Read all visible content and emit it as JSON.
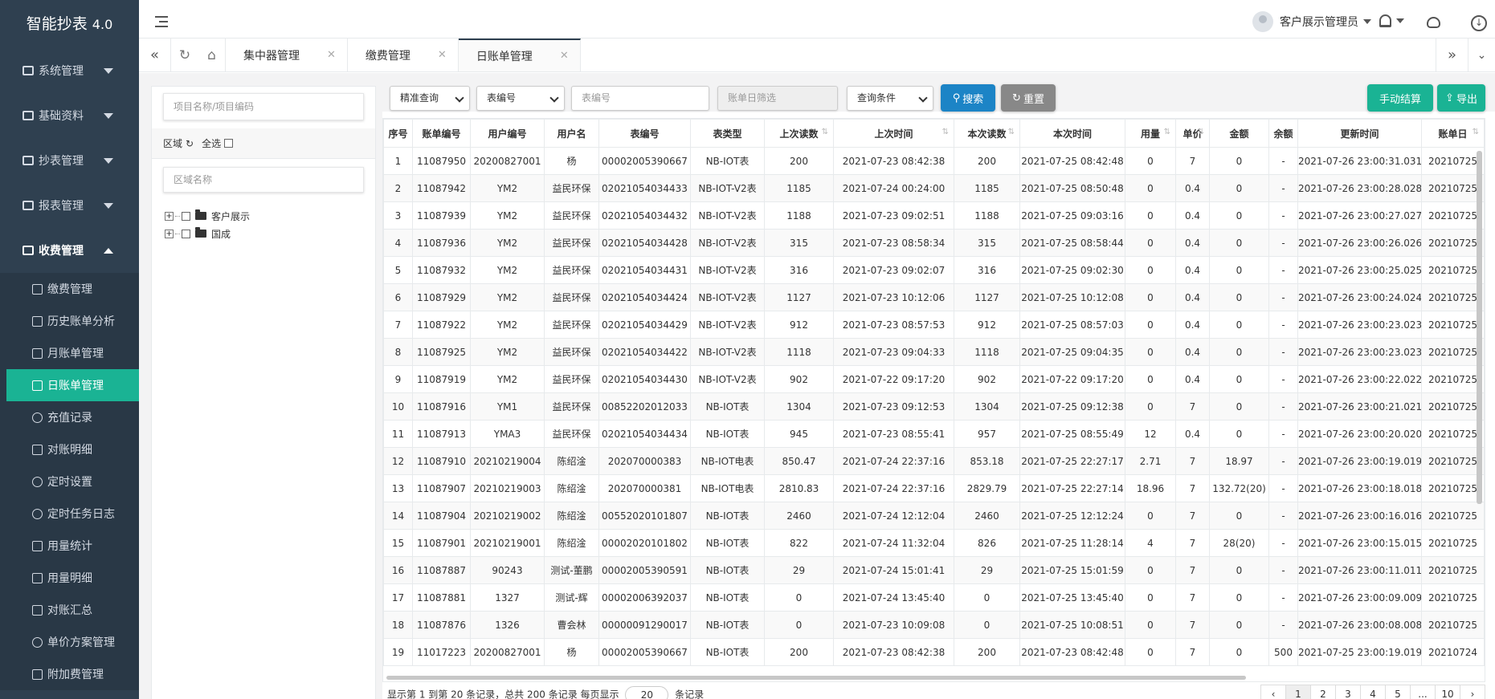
{
  "app": {
    "title": "智能抄表",
    "version": "4.0"
  },
  "sidebar": {
    "menus": [
      {
        "label": "系统管理",
        "icon": "grid-icon",
        "open": false
      },
      {
        "label": "基础资料",
        "icon": "list-icon",
        "open": false
      },
      {
        "label": "抄表管理",
        "icon": "meter-icon",
        "open": false
      },
      {
        "label": "报表管理",
        "icon": "bar-chart-icon",
        "open": false
      },
      {
        "label": "收费管理",
        "icon": "cash-icon",
        "open": true
      }
    ],
    "submenu": [
      {
        "label": "缴费管理",
        "icon": "money-icon",
        "active": false
      },
      {
        "label": "历史账单分析",
        "icon": "calendar-icon",
        "active": false
      },
      {
        "label": "月账单管理",
        "icon": "document-icon",
        "active": false
      },
      {
        "label": "日账单管理",
        "icon": "calendar-icon",
        "active": true
      },
      {
        "label": "充值记录",
        "icon": "clock-icon",
        "active": false
      },
      {
        "label": "对账明细",
        "icon": "calendar-icon",
        "active": false
      },
      {
        "label": "定时设置",
        "icon": "alarm-icon",
        "active": false
      },
      {
        "label": "定时任务日志",
        "icon": "clock-icon",
        "active": false
      },
      {
        "label": "用量统计",
        "icon": "document-icon",
        "active": false
      },
      {
        "label": "用量明细",
        "icon": "document-icon",
        "active": false
      },
      {
        "label": "对账汇总",
        "icon": "document-icon",
        "active": false
      },
      {
        "label": "单价方案管理",
        "icon": "refresh-icon",
        "active": false
      },
      {
        "label": "附加费管理",
        "icon": "money-icon",
        "active": false
      }
    ]
  },
  "header": {
    "user_name": "客户展示管理员"
  },
  "tabs": [
    {
      "label": "集中器管理",
      "active": false
    },
    {
      "label": "缴费管理",
      "active": false
    },
    {
      "label": "日账单管理",
      "active": true
    }
  ],
  "left_panel": {
    "project_placeholder": "项目名称/项目编码",
    "region_label": "区域",
    "select_all_label": "全选",
    "region_placeholder": "区域名称",
    "tree": [
      "客户展示",
      "国成"
    ]
  },
  "filters": {
    "query_mode": "精准查询",
    "field": "表编号",
    "meter_placeholder": "表编号",
    "date_placeholder": "账单日筛选",
    "condition": "查询条件",
    "search_label": "搜索",
    "reset_label": "重置",
    "settle_label": "手动结算",
    "export_label": "导出"
  },
  "table": {
    "columns": [
      "序号",
      "账单编号",
      "用户编号",
      "用户名",
      "表编号",
      "表类型",
      "上次读数",
      "上次时间",
      "本次读数",
      "本次时间",
      "用量",
      "单价",
      "金额",
      "余额",
      "更新时间",
      "账单日"
    ],
    "rows": [
      [
        "1",
        "11087950",
        "20200827001",
        "杨",
        "00002005390667",
        "NB-IOT表",
        "200",
        "2021-07-23 08:42:38",
        "200",
        "2021-07-25 08:42:48",
        "0",
        "7",
        "0",
        "-",
        "2021-07-26 23:00:31.031",
        "20210725"
      ],
      [
        "2",
        "11087942",
        "YM2",
        "益民环保",
        "02021054034433",
        "NB-IOT-V2表",
        "1185",
        "2021-07-24 00:24:00",
        "1185",
        "2021-07-25 08:50:48",
        "0",
        "0.4",
        "0",
        "-",
        "2021-07-26 23:00:28.028",
        "20210725"
      ],
      [
        "3",
        "11087939",
        "YM2",
        "益民环保",
        "02021054034432",
        "NB-IOT-V2表",
        "1188",
        "2021-07-23 09:02:51",
        "1188",
        "2021-07-25 09:03:16",
        "0",
        "0.4",
        "0",
        "-",
        "2021-07-26 23:00:27.027",
        "20210725"
      ],
      [
        "4",
        "11087936",
        "YM2",
        "益民环保",
        "02021054034428",
        "NB-IOT-V2表",
        "315",
        "2021-07-23 08:58:34",
        "315",
        "2021-07-25 08:58:44",
        "0",
        "0.4",
        "0",
        "-",
        "2021-07-26 23:00:26.026",
        "20210725"
      ],
      [
        "5",
        "11087932",
        "YM2",
        "益民环保",
        "02021054034431",
        "NB-IOT-V2表",
        "316",
        "2021-07-23 09:02:07",
        "316",
        "2021-07-25 09:02:30",
        "0",
        "0.4",
        "0",
        "-",
        "2021-07-26 23:00:25.025",
        "20210725"
      ],
      [
        "6",
        "11087929",
        "YM2",
        "益民环保",
        "02021054034424",
        "NB-IOT-V2表",
        "1127",
        "2021-07-23 10:12:06",
        "1127",
        "2021-07-25 10:12:08",
        "0",
        "0.4",
        "0",
        "-",
        "2021-07-26 23:00:24.024",
        "20210725"
      ],
      [
        "7",
        "11087922",
        "YM2",
        "益民环保",
        "02021054034429",
        "NB-IOT-V2表",
        "912",
        "2021-07-23 08:57:53",
        "912",
        "2021-07-25 08:57:03",
        "0",
        "0.4",
        "0",
        "-",
        "2021-07-26 23:00:23.023",
        "20210725"
      ],
      [
        "8",
        "11087925",
        "YM2",
        "益民环保",
        "02021054034422",
        "NB-IOT-V2表",
        "1118",
        "2021-07-23 09:04:33",
        "1118",
        "2021-07-25 09:04:35",
        "0",
        "0.4",
        "0",
        "-",
        "2021-07-26 23:00:23.023",
        "20210725"
      ],
      [
        "9",
        "11087919",
        "YM2",
        "益民环保",
        "02021054034430",
        "NB-IOT-V2表",
        "902",
        "2021-07-22 09:17:20",
        "902",
        "2021-07-22 09:17:20",
        "0",
        "0.4",
        "0",
        "-",
        "2021-07-26 23:00:22.022",
        "20210725"
      ],
      [
        "10",
        "11087916",
        "YM1",
        "益民环保",
        "00852202012033",
        "NB-IOT表",
        "1304",
        "2021-07-23 09:12:53",
        "1304",
        "2021-07-25 09:12:38",
        "0",
        "7",
        "0",
        "-",
        "2021-07-26 23:00:21.021",
        "20210725"
      ],
      [
        "11",
        "11087913",
        "YMA3",
        "益民环保",
        "02021054034434",
        "NB-IOT表",
        "945",
        "2021-07-23 08:55:41",
        "957",
        "2021-07-25 08:55:49",
        "12",
        "0.4",
        "0",
        "-",
        "2021-07-26 23:00:20.020",
        "20210725"
      ],
      [
        "12",
        "11087910",
        "20210219004",
        "陈绍淦",
        "202070000383",
        "NB-IOT电表",
        "850.47",
        "2021-07-24 22:37:16",
        "853.18",
        "2021-07-25 22:27:17",
        "2.71",
        "7",
        "18.97",
        "-",
        "2021-07-26 23:00:19.019",
        "20210725"
      ],
      [
        "13",
        "11087907",
        "20210219003",
        "陈绍淦",
        "202070000381",
        "NB-IOT电表",
        "2810.83",
        "2021-07-24 22:37:16",
        "2829.79",
        "2021-07-25 22:27:14",
        "18.96",
        "7",
        "132.72(20)",
        "-",
        "2021-07-26 23:00:18.018",
        "20210725"
      ],
      [
        "14",
        "11087904",
        "20210219002",
        "陈绍淦",
        "00552020101807",
        "NB-IOT表",
        "2460",
        "2021-07-24 12:12:04",
        "2460",
        "2021-07-25 12:12:24",
        "0",
        "7",
        "0",
        "-",
        "2021-07-26 23:00:16.016",
        "20210725"
      ],
      [
        "15",
        "11087901",
        "20210219001",
        "陈绍淦",
        "00002020101802",
        "NB-IOT表",
        "822",
        "2021-07-24 11:32:04",
        "826",
        "2021-07-25 11:28:14",
        "4",
        "7",
        "28(20)",
        "-",
        "2021-07-26 23:00:15.015",
        "20210725"
      ],
      [
        "16",
        "11087887",
        "90243",
        "测试-董鹏",
        "00002005390591",
        "NB-IOT表",
        "29",
        "2021-07-24 15:01:41",
        "29",
        "2021-07-25 15:01:59",
        "0",
        "7",
        "0",
        "-",
        "2021-07-26 23:00:11.011",
        "20210725"
      ],
      [
        "17",
        "11087881",
        "1327",
        "测试-辉",
        "00002006392037",
        "NB-IOT表",
        "0",
        "2021-07-24 13:45:40",
        "0",
        "2021-07-25 13:45:40",
        "0",
        "7",
        "0",
        "-",
        "2021-07-26 23:00:09.009",
        "20210725"
      ],
      [
        "18",
        "11087876",
        "1326",
        "曹会林",
        "00000091290017",
        "NB-IOT表",
        "0",
        "2021-07-23 10:09:08",
        "0",
        "2021-07-25 10:08:51",
        "0",
        "7",
        "0",
        "-",
        "2021-07-26 23:00:08.008",
        "20210725"
      ],
      [
        "19",
        "11017223",
        "20200827001",
        "杨",
        "00002005390667",
        "NB-IOT表",
        "200",
        "2021-07-23 08:42:38",
        "200",
        "2021-07-23 08:42:48",
        "0",
        "7",
        "0",
        "500",
        "2021-07-25 23:00:19.019",
        "20210724"
      ]
    ]
  },
  "footer": {
    "info_prefix": "显示第 1 到第 20 条记录，总共 200 条记录 每页显示",
    "page_size": "20",
    "info_suffix": "条记录",
    "pages": [
      "‹",
      "1",
      "2",
      "3",
      "4",
      "5",
      "...",
      "10",
      "›"
    ]
  },
  "colors": {
    "sidebar": "#2f4050",
    "accent": "#1ab394",
    "primary": "#1c84c6"
  }
}
